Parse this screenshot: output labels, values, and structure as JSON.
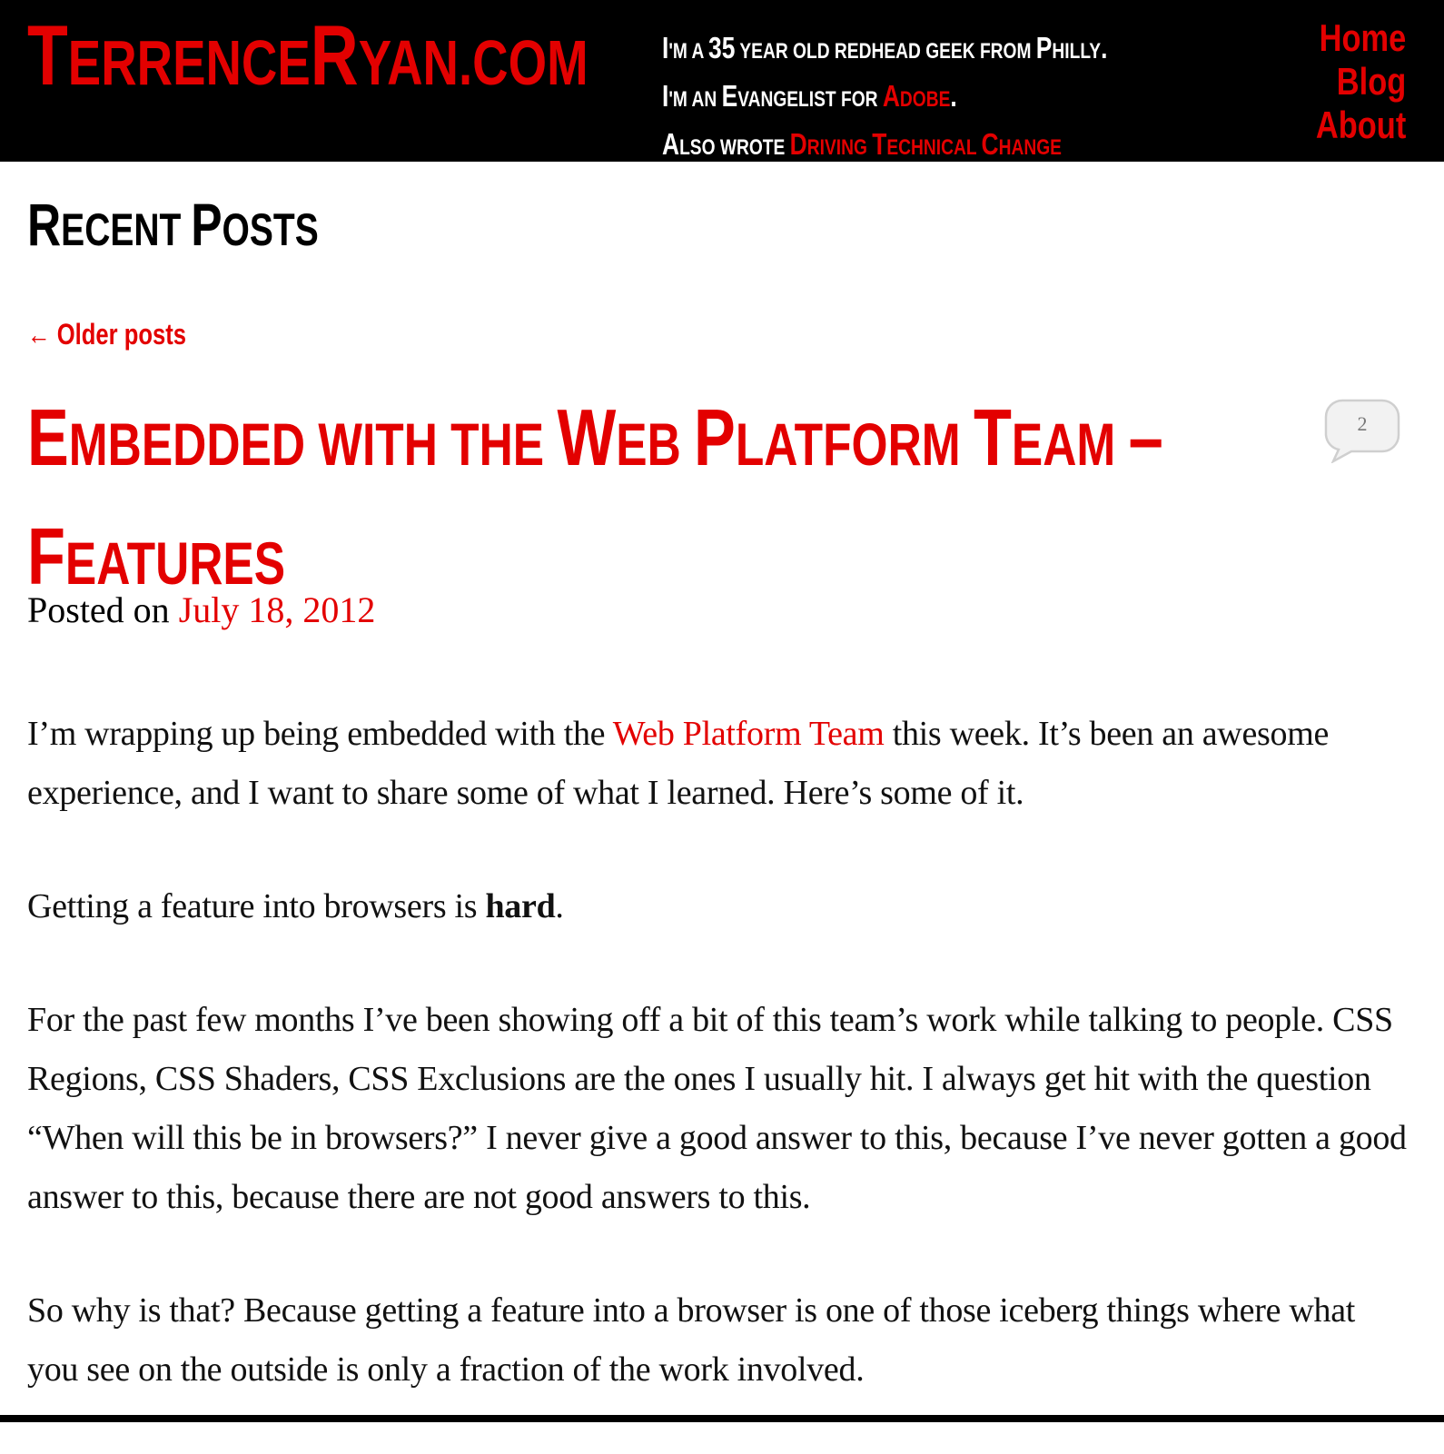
{
  "header": {
    "site_title": {
      "t_cap": "T",
      "errence_small": "ERRENCE",
      "r_cap": "R",
      "yan_small": "YAN",
      "dotcom": ".COM"
    },
    "tagline": {
      "line1": [
        {
          "t": "I",
          "s": "big"
        },
        {
          "t": "'M A ",
          "s": "small"
        },
        {
          "t": "35",
          "s": "big"
        },
        {
          "t": " YEAR OLD REDHEAD GEEK FROM ",
          "s": "small"
        },
        {
          "t": "P",
          "s": "big"
        },
        {
          "t": "HILLY",
          "s": "small"
        },
        {
          "t": ".",
          "s": "big"
        }
      ],
      "line2": [
        {
          "t": "I",
          "s": "big"
        },
        {
          "t": "'M AN ",
          "s": "small"
        },
        {
          "t": "E",
          "s": "big"
        },
        {
          "t": "VANGELIST FOR ",
          "s": "small"
        },
        {
          "t": "A",
          "s": "big red"
        },
        {
          "t": "DOBE",
          "s": "small red"
        },
        {
          "t": ".",
          "s": "big"
        }
      ],
      "line3": [
        {
          "t": "A",
          "s": "big"
        },
        {
          "t": "LSO WROTE ",
          "s": "small"
        },
        {
          "t": "D",
          "s": "big red"
        },
        {
          "t": "RIVING ",
          "s": "small red"
        },
        {
          "t": "T",
          "s": "big red"
        },
        {
          "t": "ECHNICAL ",
          "s": "small red"
        },
        {
          "t": "C",
          "s": "big red"
        },
        {
          "t": "HANGE",
          "s": "small red"
        }
      ]
    },
    "nav": {
      "home": "Home",
      "blog": "Blog",
      "about": "About"
    }
  },
  "main": {
    "recent_posts": {
      "r_cap": "R",
      "ecent_small": "ECENT ",
      "p_cap": "P",
      "osts_small": "OSTS"
    },
    "older_posts": "← Older posts",
    "post": {
      "title_line1": [
        {
          "t": "E",
          "s": "big"
        },
        {
          "t": "MBEDDED WITH THE ",
          "s": "small"
        },
        {
          "t": "W",
          "s": "big"
        },
        {
          "t": "EB ",
          "s": "small"
        },
        {
          "t": "P",
          "s": "big"
        },
        {
          "t": "LATFORM ",
          "s": "small"
        },
        {
          "t": "T",
          "s": "big"
        },
        {
          "t": "EAM ",
          "s": "small"
        },
        {
          "t": "–",
          "s": "big"
        }
      ],
      "title_line2": [
        {
          "t": "F",
          "s": "big"
        },
        {
          "t": "EATURES",
          "s": "small"
        }
      ],
      "comment_count": "2",
      "posted_on_label": "Posted on ",
      "date": "July 18, 2012",
      "paragraphs": {
        "p1_before": "I’m wrapping up being embedded with the ",
        "p1_link": "Web Platform Team",
        "p1_after": " this week.  It’s been an awesome experience, and I want to share some of what I learned. Here’s some of it.",
        "p2_before": "Getting a feature into browsers is ",
        "p2_bold": "hard",
        "p2_after": ".",
        "p3": "For the past few months I’ve been showing off a bit of this team’s work while talking to people.  CSS Regions, CSS Shaders, CSS Exclusions are the ones I usually hit. I always get hit with the question “When will this be in browsers?”  I never give a good answer to this, because I’ve never gotten a good answer to this, because there are not good answers to this.",
        "p4": "So why is that? Because getting a feature into a browser is one of those iceberg things where what you see on the outside is only a fraction of the work involved."
      }
    }
  }
}
